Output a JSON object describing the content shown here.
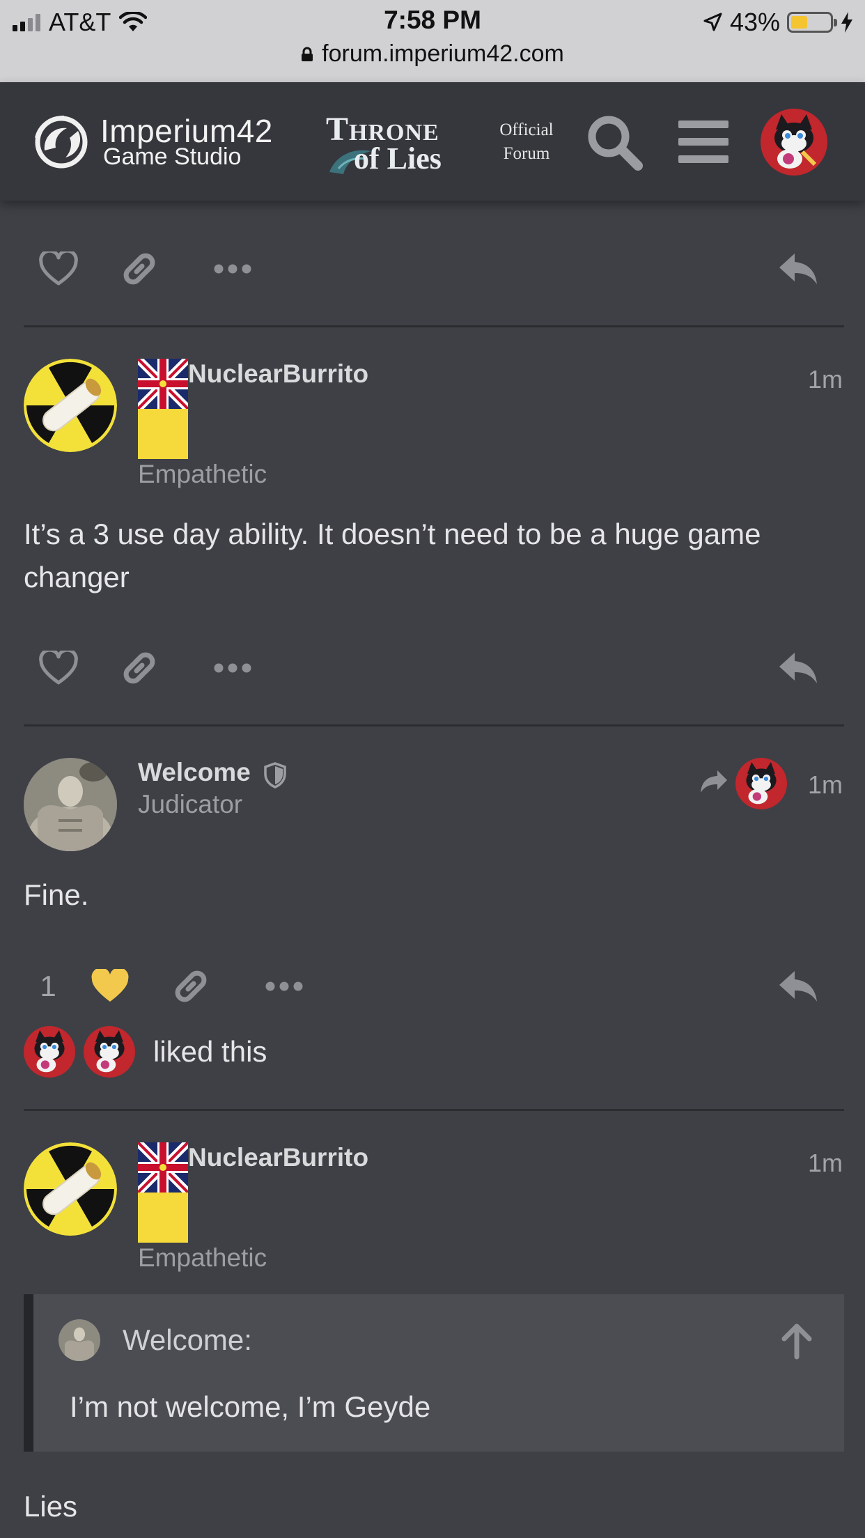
{
  "status_bar": {
    "carrier": "AT&T",
    "time": "7:58 PM",
    "battery": "43%",
    "battery_level": 0.43,
    "url": "forum.imperium42.com"
  },
  "header": {
    "studio_name": "Imperium42",
    "studio_sub": "Game Studio",
    "game_logo_line1": "Throne",
    "game_logo_line2": "of Lies",
    "official_line1": "Official",
    "official_line2": "Forum"
  },
  "posts": [
    {
      "username": "NuclearBurrito",
      "user_title": "Empathetic",
      "time": "1m",
      "body": "It’s a 3 use day ability. It doesn’t need to be a huge game changer"
    },
    {
      "username": "Welcome",
      "user_title": "Judicator",
      "time": "1m",
      "body": "Fine.",
      "like_count": "1",
      "liked_text": "liked this"
    },
    {
      "username": "NuclearBurrito",
      "user_title": "Empathetic",
      "time": "1m",
      "quote_author": "Welcome:",
      "quote_text": "I’m not welcome, I’m Geyde",
      "body": "Lies"
    }
  ],
  "colors": {
    "background": "#3e4046",
    "header": "#35373c",
    "like_active": "#f2c94c",
    "icon": "#8e9096"
  }
}
